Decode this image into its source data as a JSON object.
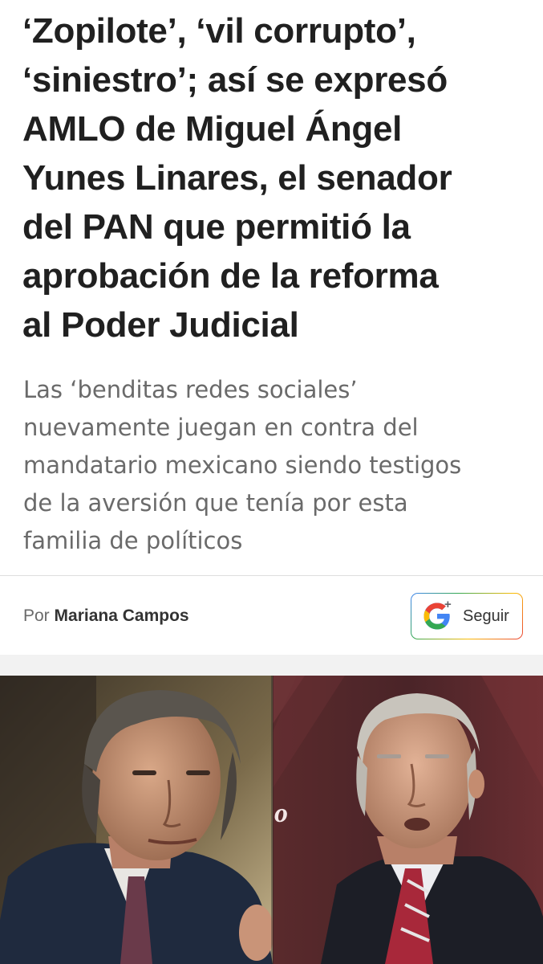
{
  "article": {
    "headline_lines": [
      "‘Zopilote’, ‘vil corrupto’,",
      "‘siniestro’; así se expresó",
      "AMLO de Miguel Ángel",
      "Yunes Linares, el senador",
      "del PAN que permitió la",
      "aprobación de la reforma",
      "al Poder Judicial"
    ],
    "subheadline_lines": [
      "Las ‘benditas redes sociales’",
      "nuevamente juegan en contra del",
      "mandatario mexicano siendo testigos",
      "de la aversión que tenía por esta",
      "familia de políticos"
    ],
    "byline": {
      "prefix": "Por",
      "author": "Mariana Campos"
    },
    "follow_button": {
      "label": "Seguir",
      "plus": "+",
      "icon": "google-g-icon"
    },
    "hero_image": {
      "description": "Split photo of two men",
      "backdrop_text": "o"
    }
  },
  "colors": {
    "headline": "#202020",
    "subheadline": "#6a6a6a",
    "divider": "#dedede",
    "google_blue": "#4285f4",
    "google_red": "#ea4335",
    "google_yellow": "#fbbc05",
    "google_green": "#34a853"
  }
}
